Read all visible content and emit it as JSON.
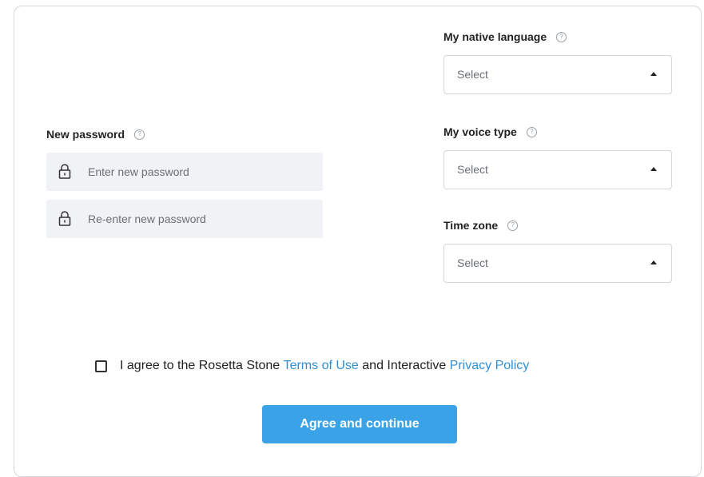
{
  "form": {
    "password": {
      "label": "New password",
      "help": "?",
      "new_placeholder": "Enter new password",
      "reenter_placeholder": "Re-enter new password"
    },
    "native_language": {
      "label": "My native language",
      "help": "?",
      "value": "Select"
    },
    "voice_type": {
      "label": "My voice type",
      "help": "?",
      "value": "Select"
    },
    "time_zone": {
      "label": "Time zone",
      "help": "?",
      "value": "Select"
    },
    "agreement": {
      "prefix": "I agree to the Rosetta Stone ",
      "terms_link": "Terms of Use",
      "middle": " and Interactive ",
      "privacy_link": "Privacy Policy",
      "checked": false
    },
    "submit_label": "Agree and continue"
  },
  "colors": {
    "accent": "#3aa3e8",
    "link": "#2e8fd6",
    "field_bg": "#f1f2f5",
    "border": "#d4d6da"
  },
  "icons": {
    "lock": "lock-icon",
    "help": "question-circle-icon",
    "caret": "caret-up-icon"
  }
}
